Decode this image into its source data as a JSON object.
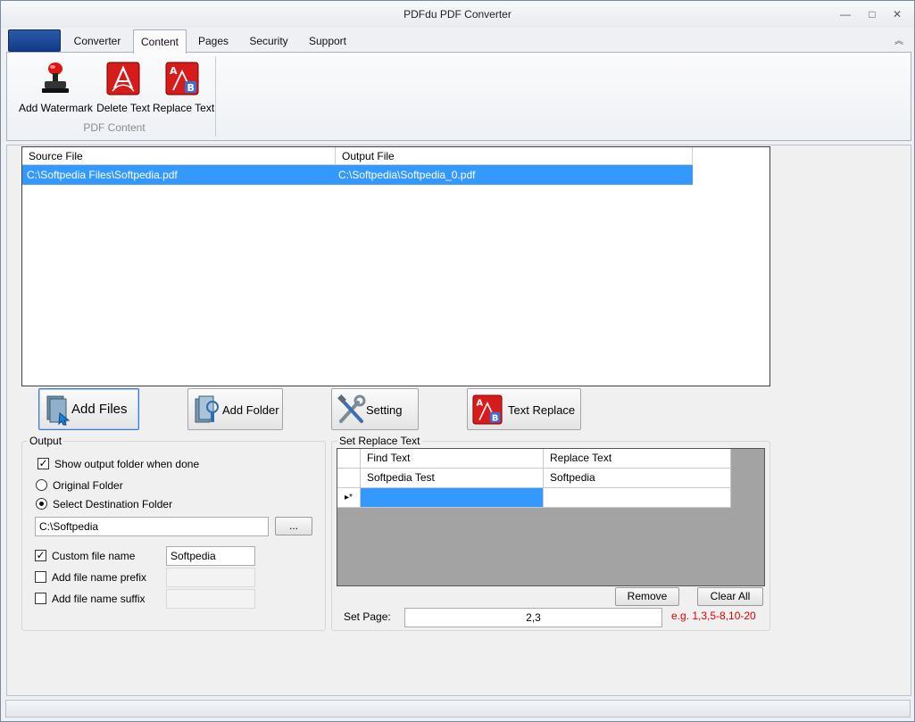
{
  "window": {
    "title": "PDFdu PDF Converter",
    "controls": {
      "minimize": "—",
      "maximize": "□",
      "close": "✕"
    }
  },
  "ribbon": {
    "tabs": [
      {
        "label": "Converter"
      },
      {
        "label": "Content"
      },
      {
        "label": "Pages"
      },
      {
        "label": "Security"
      },
      {
        "label": "Support"
      }
    ],
    "active_tab": "Content",
    "buttons": [
      {
        "label": "Add Watermark",
        "icon": "stamp-icon"
      },
      {
        "label": "Delete Text",
        "icon": "delete-text-icon"
      },
      {
        "label": "Replace Text",
        "icon": "replace-text-icon"
      }
    ],
    "group_label": "PDF Content",
    "collapse_glyph": "︽"
  },
  "file_list": {
    "columns": [
      "Source File",
      "Output File"
    ],
    "rows": [
      {
        "source": "C:\\Softpedia Files\\Softpedia.pdf",
        "output": "C:\\Softpedia\\Softpedia_0.pdf"
      }
    ],
    "selected_color": "#3399ff"
  },
  "actions": {
    "add_files": "Add Files",
    "add_folder": "Add Folder",
    "setting": "Setting",
    "text_replace": "Text Replace"
  },
  "output": {
    "title": "Output",
    "show_output_folder": {
      "label": "Show output folder when done",
      "checked": true
    },
    "original_folder": {
      "label": "Original Folder",
      "selected": false
    },
    "select_destination": {
      "label": "Select Destination Folder",
      "selected": true
    },
    "destination_path": "C:\\Softpedia",
    "browse_label": "...",
    "custom_file_name": {
      "label": "Custom file name",
      "checked": true,
      "value": "Softpedia"
    },
    "prefix": {
      "label": "Add file name prefix",
      "checked": false,
      "value": ""
    },
    "suffix": {
      "label": "Add file name suffix",
      "checked": false,
      "value": ""
    }
  },
  "replace": {
    "title": "Set Replace Text",
    "columns": [
      "Find Text",
      "Replace Text"
    ],
    "rows": [
      {
        "find": "Softpedia Test",
        "replace": "Softpedia"
      }
    ],
    "new_row_marker": "▸*",
    "remove_label": "Remove",
    "clear_all_label": "Clear All",
    "set_page_label": "Set Page:",
    "set_page_value": "2,3",
    "page_example": "e.g. 1,3,5-8,10-20",
    "example_color": "#e00000"
  }
}
